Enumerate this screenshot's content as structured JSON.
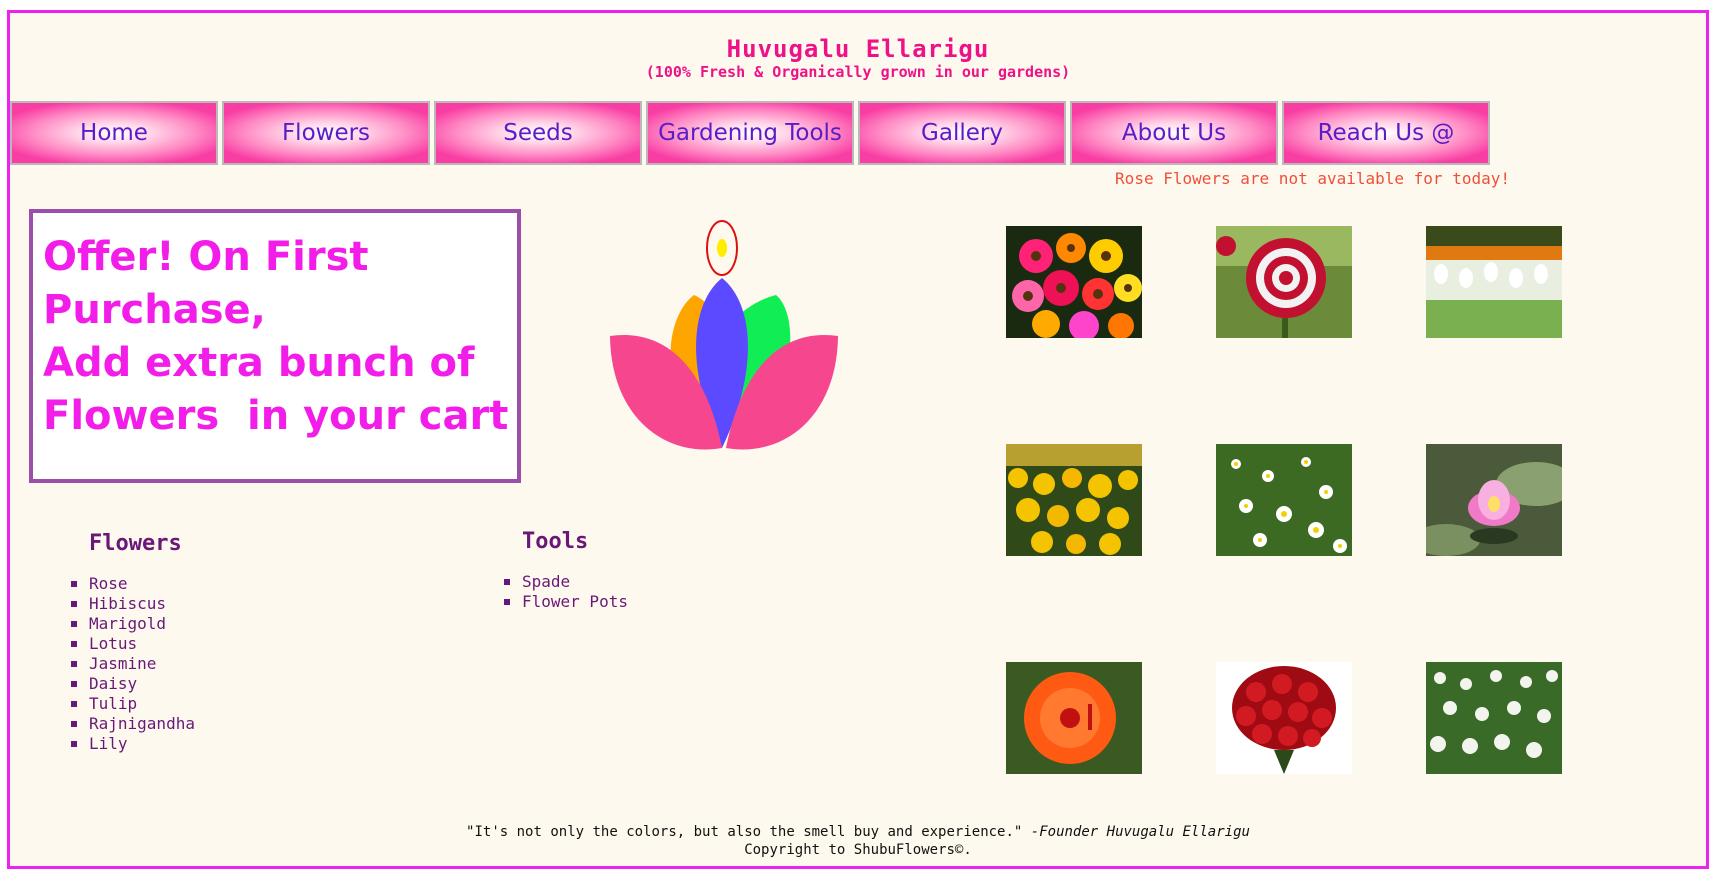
{
  "header": {
    "title": "Huvugalu Ellarigu",
    "tagline": "(100% Fresh & Organically grown in our gardens)"
  },
  "nav": {
    "items": [
      "Home",
      "Flowers",
      "Seeds",
      "Gardening Tools",
      "Gallery",
      "About Us",
      "Reach Us @"
    ]
  },
  "notice": "Rose Flowers are not available for today!",
  "offer": {
    "line1": "Offer! On First",
    "line2": "Purchase,",
    "line3": "Add extra bunch of",
    "line4": "Flowers  in your cart"
  },
  "flowers_list": {
    "heading": "Flowers",
    "items": [
      "Rose",
      "Hibiscus",
      "Marigold",
      "Lotus",
      "Jasmine",
      "Daisy",
      "Tulip",
      "Rajnigandha",
      "Lily"
    ]
  },
  "tools_list": {
    "heading": "Tools",
    "items": [
      "Spade",
      "Flower Pots"
    ]
  },
  "footer": {
    "quote": "\"It's not only the colors, but also the smell buy and experience.\"",
    "quote_author": "-Founder Huvugalu Ellarigu",
    "copyright": "Copyright to ShubuFlowers©."
  },
  "colors": {
    "page_border": "#ee22ee",
    "background": "#fef9ee",
    "title": "#ee1188",
    "nav_text": "#5a1cc8",
    "notice": "#ef4f3a",
    "offer_text": "#f21de8",
    "list_text": "#6a1878"
  }
}
